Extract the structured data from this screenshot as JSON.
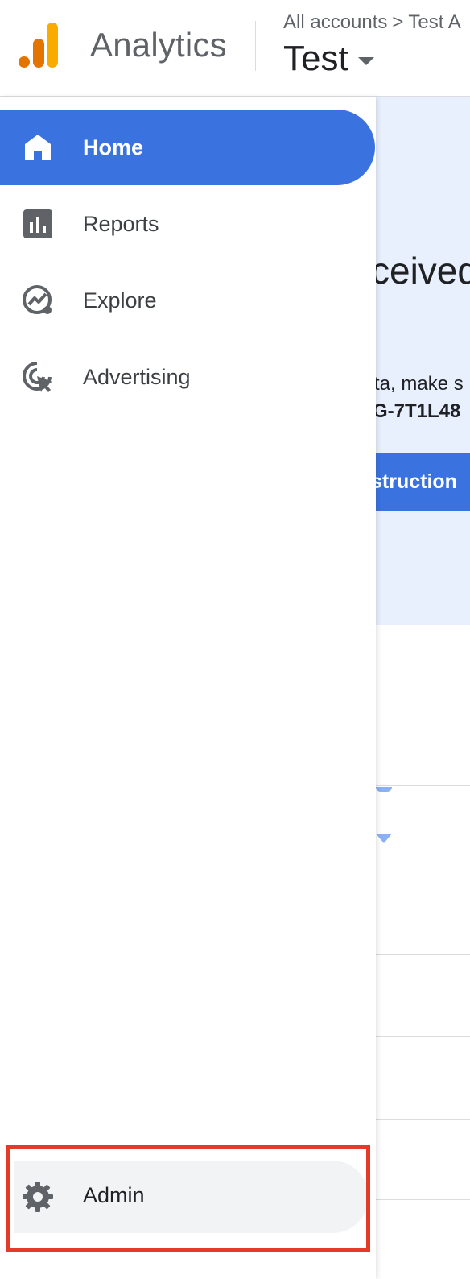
{
  "header": {
    "product_name": "Analytics",
    "breadcrumb": {
      "accounts": "All accounts",
      "separator": ">",
      "account": "Test A"
    },
    "property_name": "Test"
  },
  "nav": {
    "items": [
      {
        "label": "Home",
        "icon": "home-icon",
        "active": true
      },
      {
        "label": "Reports",
        "icon": "reports-icon",
        "active": false
      },
      {
        "label": "Explore",
        "icon": "explore-icon",
        "active": false
      },
      {
        "label": "Advertising",
        "icon": "advertising-icon",
        "active": false
      }
    ],
    "admin": {
      "label": "Admin",
      "icon": "gear-icon",
      "highlighted": true
    }
  },
  "background": {
    "banner_heading": "ceived",
    "banner_text": "ta, make s",
    "banner_id": "G-7T1L48",
    "banner_button": "struction"
  },
  "colors": {
    "accent": "#3a72df",
    "banner_bg": "#e8f0fe",
    "highlight": "#e53a28",
    "logo_dark": "#e37400",
    "logo_light": "#f9ab00"
  }
}
